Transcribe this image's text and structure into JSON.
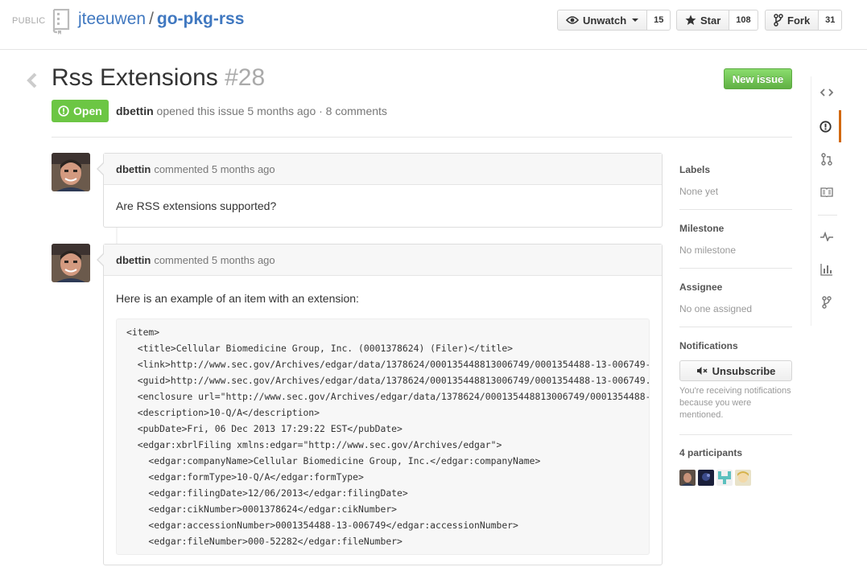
{
  "header": {
    "visibility": "PUBLIC",
    "owner": "jteeuwen",
    "separator": "/",
    "repo": "go-pkg-rss",
    "buttons": {
      "watch": {
        "label": "Unwatch",
        "count": "15"
      },
      "star": {
        "label": "Star",
        "count": "108"
      },
      "fork": {
        "label": "Fork",
        "count": "31"
      }
    }
  },
  "issue": {
    "title": "Rss Extensions",
    "number": "#28",
    "state": "Open",
    "author": "dbettin",
    "opened_text": "opened this issue 5 months ago · 8 comments",
    "new_issue_label": "New issue"
  },
  "comments": [
    {
      "author": "dbettin",
      "action": "commented 5 months ago",
      "body": "Are RSS extensions supported?"
    },
    {
      "author": "dbettin",
      "action": "commented 5 months ago",
      "body": "Here is an example of an item with an extension:",
      "code": "<item>\n  <title>Cellular Biomedicine Group, Inc. (0001378624) (Filer)</title>\n  <link>http://www.sec.gov/Archives/edgar/data/1378624/000135448813006749/0001354488-13-006749-index.htm</link>\n  <guid>http://www.sec.gov/Archives/edgar/data/1378624/000135448813006749/0001354488-13-006749.txt</guid>\n  <enclosure url=\"http://www.sec.gov/Archives/edgar/data/1378624/000135448813006749/0001354488-13-006749-xbrl.zip\"\n  <description>10-Q/A</description>\n  <pubDate>Fri, 06 Dec 2013 17:29:22 EST</pubDate>\n  <edgar:xbrlFiling xmlns:edgar=\"http://www.sec.gov/Archives/edgar\">\n    <edgar:companyName>Cellular Biomedicine Group, Inc.</edgar:companyName>\n    <edgar:formType>10-Q/A</edgar:formType>\n    <edgar:filingDate>12/06/2013</edgar:filingDate>\n    <edgar:cikNumber>0001378624</edgar:cikNumber>\n    <edgar:accessionNumber>0001354488-13-006749</edgar:accessionNumber>\n    <edgar:fileNumber>000-52282</edgar:fileNumber>"
    }
  ],
  "sidebar": {
    "labels": {
      "heading": "Labels",
      "value": "None yet"
    },
    "milestone": {
      "heading": "Milestone",
      "value": "No milestone"
    },
    "assignee": {
      "heading": "Assignee",
      "value": "No one assigned"
    },
    "notifications": {
      "heading": "Notifications",
      "button": "Unsubscribe",
      "text": "You're receiving notifications because you were mentioned."
    },
    "participants": {
      "heading": "4 participants"
    }
  },
  "repo_nav": {
    "items": [
      "code-icon",
      "issues-icon",
      "pull-requests-icon",
      "wiki-icon",
      "pulse-icon",
      "graphs-icon",
      "network-icon"
    ],
    "selected": "issues-icon",
    "accent": "#d26911"
  },
  "colors": {
    "link": "#4078c0",
    "open_state": "#6cc644",
    "new_issue": "#60b044"
  }
}
